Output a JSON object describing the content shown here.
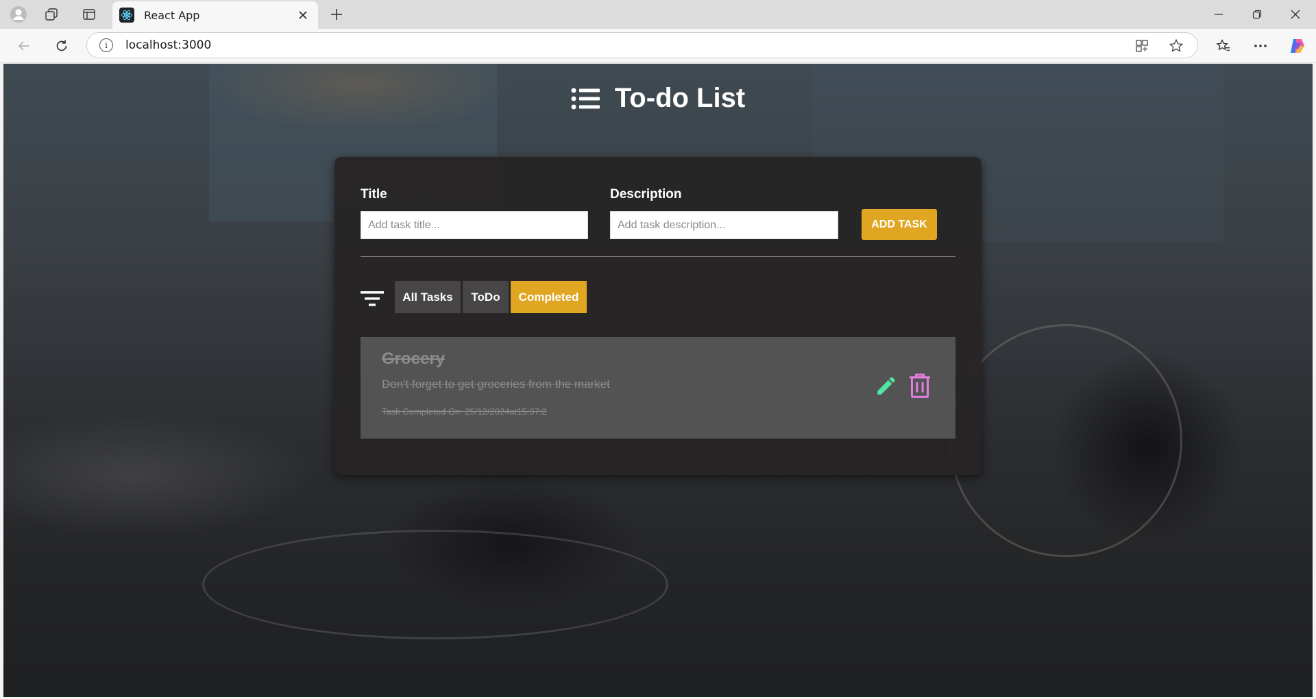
{
  "browser": {
    "tab_title": "React App",
    "url": "localhost:3000"
  },
  "app": {
    "title": "To-do List",
    "form": {
      "title_label": "Title",
      "title_placeholder": "Add task title...",
      "title_value": "",
      "description_label": "Description",
      "description_placeholder": "Add task description...",
      "description_value": "",
      "add_button": "ADD TASK"
    },
    "filters": [
      {
        "label": "All Tasks",
        "active": false
      },
      {
        "label": "ToDo",
        "active": false
      },
      {
        "label": "Completed",
        "active": true
      }
    ],
    "tasks": [
      {
        "title": "Grocery",
        "description": "Don't forget to get groceries from the market",
        "completed_on": "Task Completed On: 25/12/2024at15:37:2",
        "completed": true
      }
    ]
  },
  "colors": {
    "accent": "#e0a622",
    "edit_icon": "#4ee6a0",
    "delete_icon": "#e37fe0"
  },
  "icons": [
    "profile-icon",
    "workspaces-icon",
    "tab-actions-icon",
    "react-favicon",
    "close-icon",
    "new-tab-icon",
    "minimize-icon",
    "restore-icon",
    "window-close-icon",
    "back-icon",
    "reload-icon",
    "info-icon",
    "app-view-icon",
    "favorite-star-icon",
    "favorites-icon",
    "more-icon",
    "copilot-icon",
    "list-icon",
    "filter-icon",
    "edit-icon",
    "delete-icon"
  ]
}
